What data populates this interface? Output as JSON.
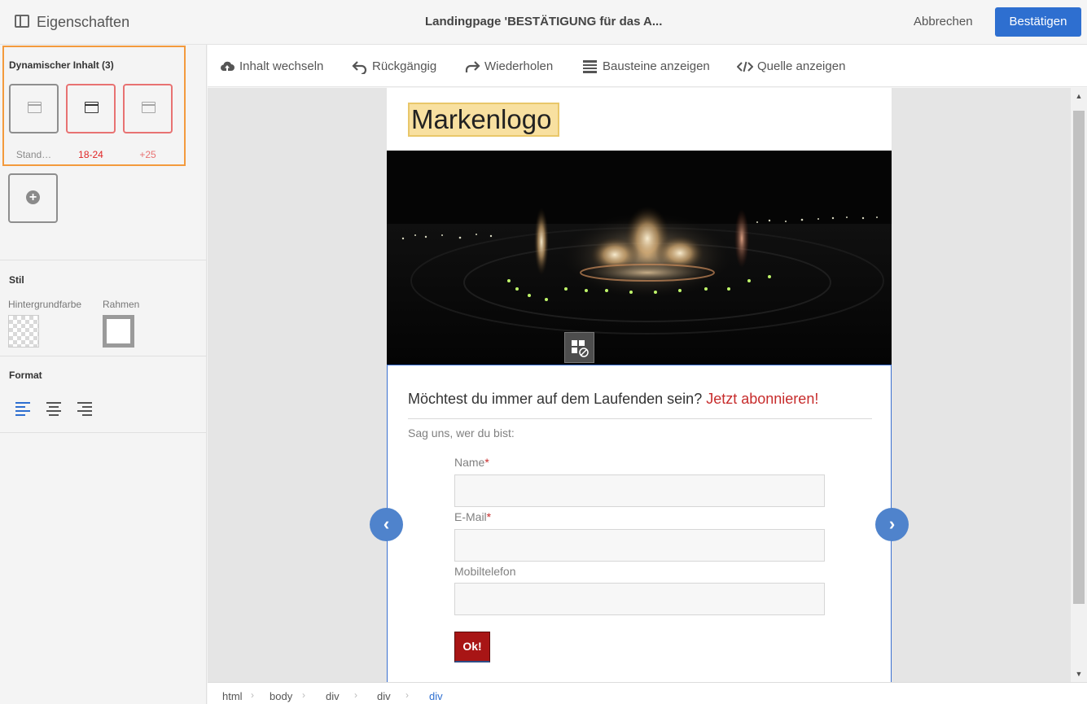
{
  "header": {
    "panel_title": "Eigenschaften",
    "document_title": "Landingpage 'BESTÄTIGUNG für das A...",
    "cancel_label": "Abbrechen",
    "confirm_label": "Bestätigen"
  },
  "sidebar": {
    "dynamic_content": {
      "title": "Dynamischer Inhalt (3)",
      "variants": [
        {
          "label": "Stand…",
          "label_color": "#8a8a8a",
          "border_color": "#8e8e8e",
          "active": false
        },
        {
          "label": "18-24",
          "label_color": "#e02424",
          "border_color": "#e87272",
          "active": true
        },
        {
          "label": "+25",
          "label_color": "#e87272",
          "border_color": "#e87272",
          "active": false
        }
      ],
      "add_icon": "plus-circle-icon"
    },
    "style": {
      "title": "Stil",
      "background_label": "Hintergrundfarbe",
      "border_label": "Rahmen"
    },
    "format": {
      "title": "Format",
      "alignments": [
        "align-left-icon",
        "align-center-icon",
        "align-right-icon"
      ],
      "active_alignment": "left"
    }
  },
  "toolbar": {
    "items": [
      {
        "label": "Inhalt wechseln",
        "icon": "cloud-upload-icon"
      },
      {
        "label": "Rückgängig",
        "icon": "undo-icon"
      },
      {
        "label": "Wiederholen",
        "icon": "redo-icon"
      },
      {
        "label": "Bausteine anzeigen",
        "icon": "list-icon"
      },
      {
        "label": "Quelle anzeigen",
        "icon": "code-icon"
      }
    ]
  },
  "page": {
    "logo_text": "Markenlogo",
    "hero_image": "night-fountain-image",
    "headline": "Möchtest du immer auf dem Laufenden sein?",
    "headline_accent": "Jetzt abonnieren!",
    "intro": "Sag uns, wer du bist:",
    "fields": [
      {
        "label": "Name",
        "required": "*",
        "value": ""
      },
      {
        "label": "E-Mail",
        "required": "*",
        "value": ""
      },
      {
        "label": "Mobiltelefon",
        "required": "",
        "value": ""
      }
    ],
    "submit_label": "Ok!"
  },
  "breadcrumb": [
    "html",
    "body",
    "div",
    "div",
    "div"
  ],
  "colors": {
    "accent_blue": "#2e6fd0",
    "highlight_orange": "#f39a3d",
    "brand_red": "#a81515",
    "required_red": "#c72c2c"
  }
}
